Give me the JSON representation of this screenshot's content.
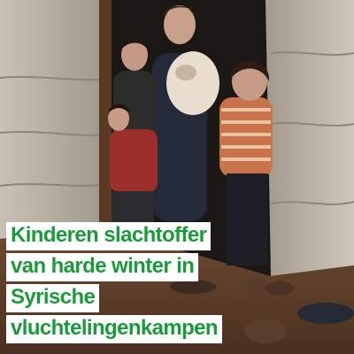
{
  "headline": {
    "lines": [
      "Kinderen slachtoffer",
      "van harde winter in",
      "Syrische",
      "vluchtelingenkampen"
    ]
  },
  "colors": {
    "headline_text": "#1b9a3c",
    "headline_background": "#ffffff"
  }
}
